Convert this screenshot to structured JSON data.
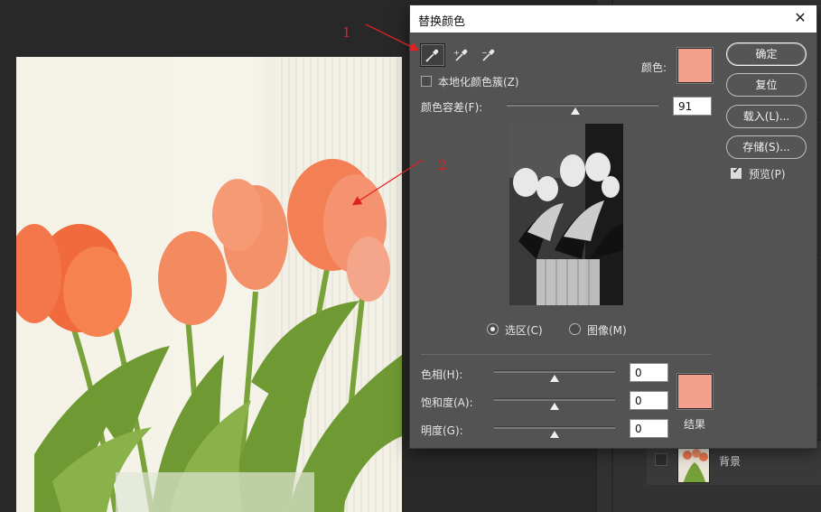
{
  "dialog": {
    "title": "替换颜色",
    "close_icon": "close-icon",
    "tools": [
      {
        "name": "eyedropper-icon",
        "active": true
      },
      {
        "name": "eyedropper-plus-icon",
        "active": false
      },
      {
        "name": "eyedropper-minus-icon",
        "active": false
      }
    ],
    "localized_clusters_label": "本地化颜色簇(Z)",
    "color_label": "颜色:",
    "fuzziness_label": "颜色容差(F):",
    "fuzziness_value": "91",
    "fuzziness_fraction": 0.45,
    "selection_label": "选区(C)",
    "image_label": "图像(M)",
    "hue_label": "色相(H):",
    "hue_value": "0",
    "saturation_label": "饱和度(A):",
    "saturation_value": "0",
    "lightness_label": "明度(G):",
    "lightness_value": "0",
    "result_label": "结果",
    "buttons": {
      "ok": "确定",
      "reset": "复位",
      "load": "载入(L)...",
      "save": "存储(S)..."
    },
    "preview_label": "预览(P)",
    "colors": {
      "target": "#f4a08c",
      "result": "#f4a08c"
    }
  },
  "layers": {
    "background_name": "背景"
  },
  "annotations": {
    "one": "1",
    "two": "2"
  }
}
